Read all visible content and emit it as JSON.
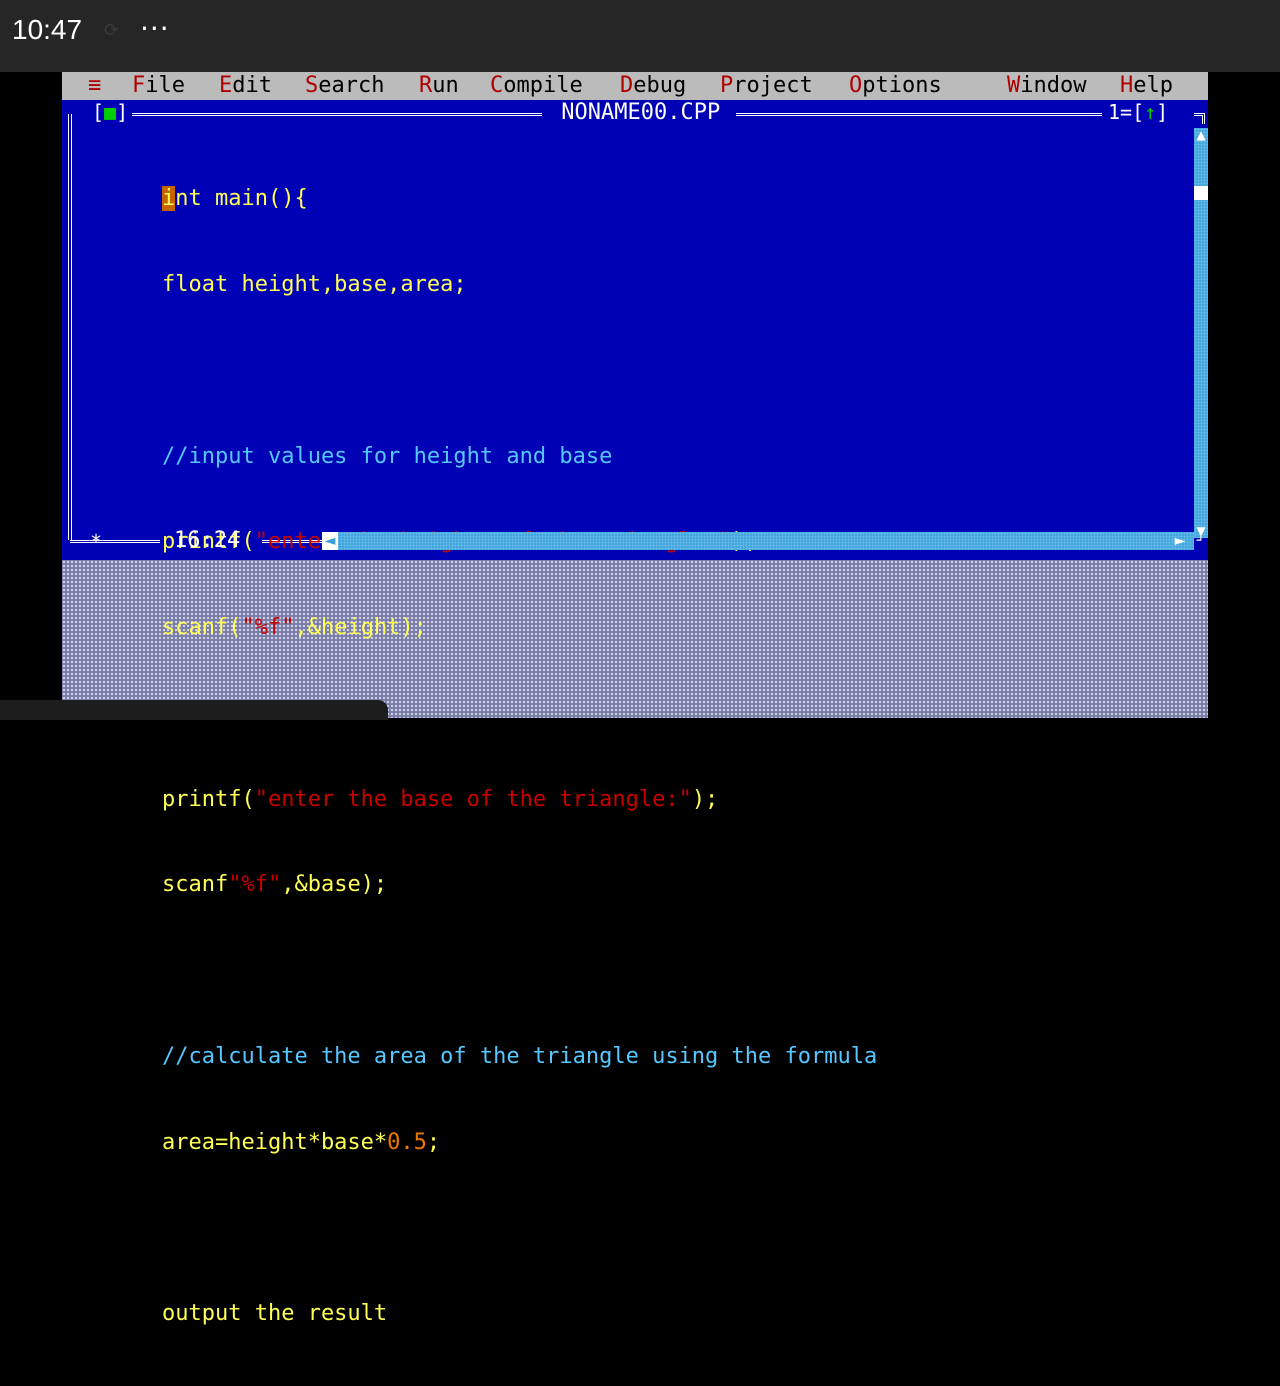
{
  "status_bar": {
    "time": "10:47",
    "sync_icon": "⟳",
    "more": "···"
  },
  "menu": {
    "system": "≡",
    "items": [
      {
        "hot": "F",
        "rest": "ile"
      },
      {
        "hot": "E",
        "rest": "dit"
      },
      {
        "hot": "S",
        "rest": "earch"
      },
      {
        "hot": "R",
        "rest": "un"
      },
      {
        "hot": "C",
        "rest": "ompile"
      },
      {
        "hot": "D",
        "rest": "ebug"
      },
      {
        "hot": "P",
        "rest": "roject"
      },
      {
        "hot": "O",
        "rest": "ptions"
      },
      {
        "hot": "W",
        "rest": "indow"
      },
      {
        "hot": "H",
        "rest": "elp"
      }
    ]
  },
  "editor": {
    "close_box_left": "[",
    "close_box_mark": "■",
    "close_box_right": "]",
    "file_title": " NONAME00.CPP ",
    "window_number": "1=[",
    "window_zoom": "↑",
    "window_close": "]",
    "cursor_position": "16:24",
    "modified_marker": "*",
    "code": {
      "l1_cursor": "i",
      "l1_rest": "nt main(){",
      "l2": "float height,base,area;",
      "l4": "//input values for height and base",
      "l5_a": "printf(",
      "l5_str": "\"enter the heightm of the triangle:\"",
      "l5_b": ");",
      "l6_a": "scanf(",
      "l6_str": "\"%f\"",
      "l6_b": ",&height);",
      "l8_a": "printf(",
      "l8_str": "\"enter the base of the triangle:\"",
      "l8_b": ");",
      "l9_a": "scanf",
      "l9_str": "\"%f\"",
      "l9_b": ",&base);",
      "l11": "//calculate the area of the triangle using the formula",
      "l12_a": "area=height*base*",
      "l12_num": "0.5",
      "l12_b": ";",
      "l14": "output the result"
    }
  },
  "colors": {
    "editor_bg": "#0000b4",
    "menu_bg": "#bbbbbb",
    "keyword": "#ffff55",
    "comment": "#55c8ff",
    "string": "#c80000",
    "number": "#ee7700"
  }
}
